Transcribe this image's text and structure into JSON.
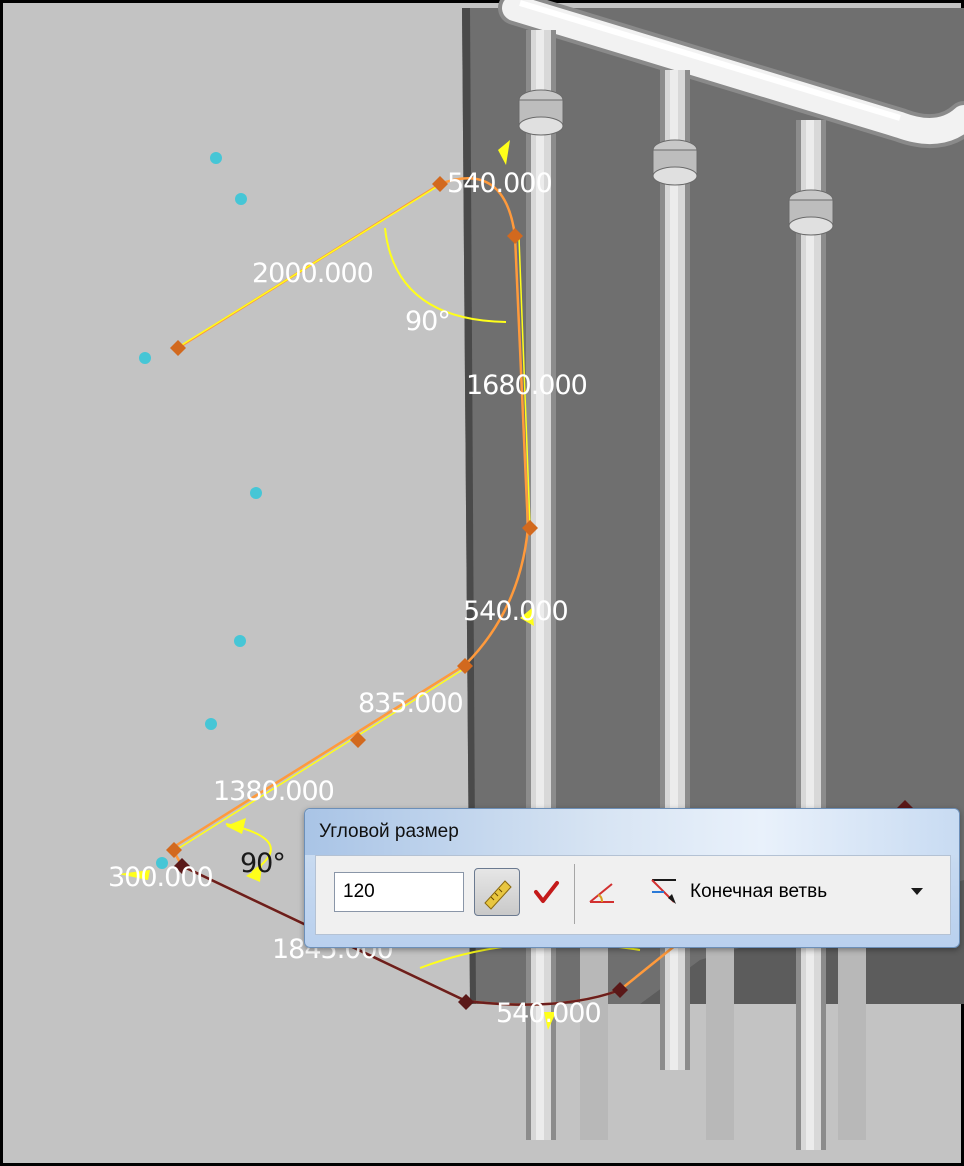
{
  "dimensions": {
    "top_straight": "2000.000",
    "top_bend": "540.000",
    "vertical_straight": "1680.000",
    "middle_bend": "540.000",
    "lower_segment": "835.000",
    "long_segment": "1380.000",
    "short_segment": "300.000",
    "bottom_segment": "1845.000",
    "bottom_bend": "540.000",
    "upper_angle": "90°",
    "lower_angle": "90°"
  },
  "toolbar": {
    "title": "Угловой размер",
    "value": "120",
    "branch_option": "Конечная ветвь"
  },
  "colors": {
    "pipe_route": "#ff9a3c",
    "dimension": "#ffff1a",
    "node": "#d2691e",
    "point": "#46c6d6",
    "background": "#c3c3c3",
    "wall": "#6f6f6f"
  }
}
